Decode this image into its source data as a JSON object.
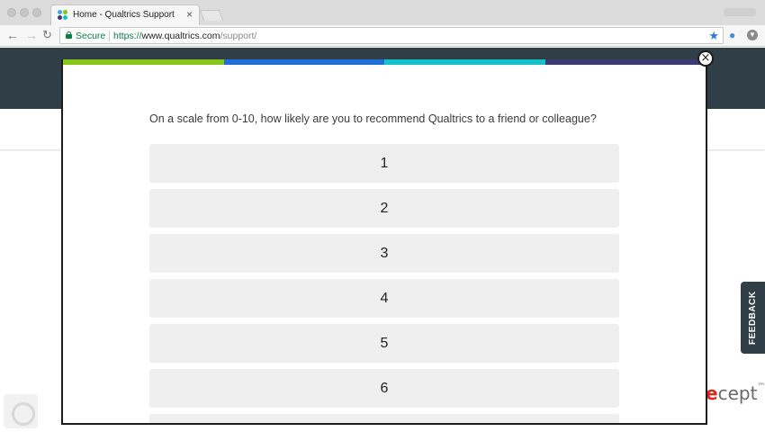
{
  "browser": {
    "tab_title": "Home - Qualtrics Support",
    "tab_close": "×",
    "secure_label": "Secure",
    "url_protocol": "https://",
    "url_host": "www.qualtrics.com",
    "url_path": "/support/"
  },
  "survey": {
    "question": "On a scale from 0-10, how likely are you to recommend Qualtrics to a friend or colleague?",
    "options": [
      "1",
      "2",
      "3",
      "4",
      "5",
      "6"
    ],
    "strip_colors": [
      "#86c516",
      "#1f6fd6",
      "#13c2c6",
      "#3c3a73"
    ],
    "close_glyph": "×"
  },
  "page": {
    "feedback_label": "FEEDBACK",
    "logo_e": "e",
    "logo_rest": "cept",
    "logo_tm": "™"
  }
}
